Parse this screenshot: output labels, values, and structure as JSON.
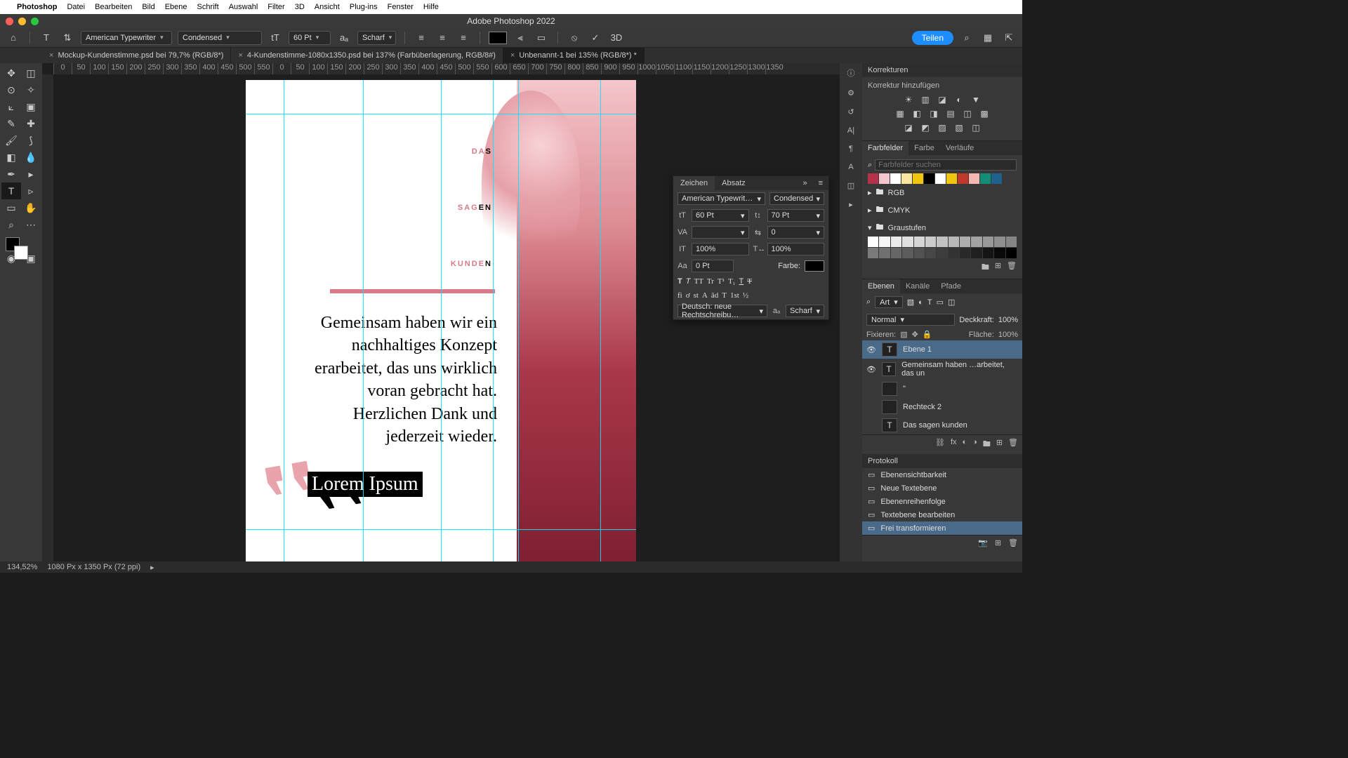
{
  "mac_menu": {
    "app": "Photoshop",
    "items": [
      "Datei",
      "Bearbeiten",
      "Bild",
      "Ebene",
      "Schrift",
      "Auswahl",
      "Filter",
      "3D",
      "Ansicht",
      "Plug-ins",
      "Fenster",
      "Hilfe"
    ]
  },
  "window_title": "Adobe Photoshop 2022",
  "options": {
    "font_family": "American Typewriter",
    "font_style": "Condensed",
    "font_size": "60 Pt",
    "aa": "Scharf",
    "share": "Teilen"
  },
  "tabs": [
    {
      "label": "Mockup-Kundenstimme.psd bei 79,7% (RGB/8*)",
      "active": false
    },
    {
      "label": "4-Kundenstimme-1080x1350.psd bei 137% (Farbüberlagerung, RGB/8#)",
      "active": false
    },
    {
      "label": "Unbenannt-1 bei 135% (RGB/8*) *",
      "active": true
    }
  ],
  "ruler_ticks": [
    "0",
    "50",
    "100",
    "150",
    "200",
    "250",
    "300",
    "350",
    "400",
    "450",
    "500",
    "550",
    "0",
    "50",
    "100",
    "150",
    "200",
    "250",
    "300",
    "350",
    "400",
    "450",
    "500",
    "550",
    "600",
    "650",
    "700",
    "750",
    "800",
    "850",
    "900",
    "950",
    "1000",
    "1050",
    "1100",
    "1150",
    "1200",
    "1250",
    "1300",
    "1350"
  ],
  "doc": {
    "l1a": "DA",
    "l1b": "S",
    "l2a": "SAG",
    "l2b": "EN",
    "l3a": "KUNDE",
    "l3b": "N",
    "body": "Gemeinsam haben wir ein nachhaltiges Konzept erarbeitet, das uns wirklich voran gebracht hat. Herzlichen Dank und jederzeit wieder.",
    "editing": "Lorem Ipsum"
  },
  "zeichen": {
    "tab1": "Zeichen",
    "tab2": "Absatz",
    "font": "American Typewrit…",
    "style": "Condensed",
    "size": "60 Pt",
    "leading": "70 Pt",
    "va": "VA",
    "kern": "0",
    "hscale": "100%",
    "vscale": "100%",
    "baseline_label": "Aa",
    "baseline": "0 Pt",
    "farbe_label": "Farbe:",
    "lang": "Deutsch: neue Rechtschreibu…",
    "aa": "Scharf"
  },
  "korrekturen": {
    "title": "Korrekturen",
    "add": "Korrektur hinzufügen"
  },
  "farbfelder": {
    "tabs": [
      "Farbfelder",
      "Farbe",
      "Verläufe"
    ],
    "search_ph": "Farbfelder suchen",
    "swatches": [
      "#b5324a",
      "#f4c6ce",
      "#ffffff",
      "#f9e79f",
      "#f1c40f",
      "#000000",
      "#ffffff",
      "#f1c40f",
      "#c0392b",
      "#f5b7b1",
      "#138d75",
      "#1f618d"
    ],
    "folders": [
      "RGB",
      "CMYK",
      "Graustufen"
    ]
  },
  "ebenen": {
    "tabs": [
      "Ebenen",
      "Kanäle",
      "Pfade"
    ],
    "filter_ph": "Art",
    "blend": "Normal",
    "opacity_label": "Deckkraft:",
    "opacity": "100%",
    "lock_label": "Fixieren:",
    "fill_label": "Fläche:",
    "fill": "100%",
    "layers": [
      {
        "eye": true,
        "type": "T",
        "name": "Ebene 1",
        "active": true
      },
      {
        "eye": true,
        "type": "T",
        "name": "Gemeinsam haben …arbeitet, das un"
      },
      {
        "eye": false,
        "type": "R",
        "name": "\""
      },
      {
        "eye": false,
        "type": "R",
        "name": "Rechteck 2"
      },
      {
        "eye": false,
        "type": "T",
        "name": "Das  sagen kunden"
      }
    ]
  },
  "protokoll": {
    "title": "Protokoll",
    "items": [
      {
        "name": "Ebenensichtbarkeit"
      },
      {
        "name": "Neue Textebene"
      },
      {
        "name": "Ebenenreihenfolge"
      },
      {
        "name": "Textebene bearbeiten"
      },
      {
        "name": "Frei transformieren",
        "active": true
      }
    ]
  },
  "status": {
    "zoom": "134,52%",
    "info": "1080 Px x 1350 Px (72 ppi)"
  }
}
